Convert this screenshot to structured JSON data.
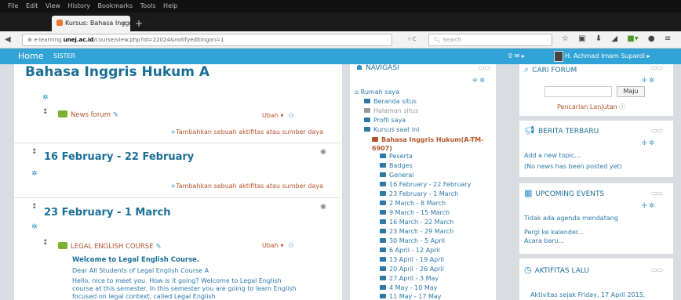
{
  "browser": {
    "menu": [
      "File",
      "Edit",
      "View",
      "History",
      "Bookmarks",
      "Tools",
      "Help"
    ],
    "tab_title": "Kursus: Bahasa Inggris Huk...",
    "url_pre": "e-learning.",
    "url_host": "unej.ac.id",
    "url_post": "/course/view.php?id=22024&notifyeditingon=1",
    "search_placeholder": "Search"
  },
  "topbar": {
    "home": "Home",
    "sister": "SISTER",
    "messages": "0",
    "user": "H. Achmad Imam Supardi"
  },
  "main": {
    "course_title": "Bahasa Inggris Hukum A",
    "news_forum": "News forum",
    "edit_label": "Ubah",
    "add_activity": "Tambahkan sebuah aktifitas atau sumber daya",
    "sections": [
      {
        "title": "16 February - 22 February"
      },
      {
        "title": "23 February - 1 March"
      }
    ],
    "legal_course": "LEGAL ENGLISH COURSE",
    "welcome": "Welcome to Legal English Course.",
    "greeting": "Dear All Students of Legal English Course A",
    "body": "Hello, nice to meet you. How is it going? Welcome to Legal English course at this semester. In this semester you are going to learn English focused on legal context, called Legal English"
  },
  "navigation": {
    "title": "NAVIGASI",
    "rumah": "Rumah saya",
    "beranda": "Beranda situs",
    "halaman": "Halaman situs",
    "profil": "Profil saya",
    "kursus": "Kursus saat ini",
    "current_course": "Bahasa Inggris Hukum(A-TM-6907)",
    "items": [
      "Peserta",
      "Badges",
      "General",
      "16 February - 22 February",
      "23 February - 1 March",
      "2 March - 8 March",
      "9 March - 15 March",
      "16 March - 22 March",
      "23 March - 29 March",
      "30 March - 5 April",
      "6 April - 12 April",
      "13 April - 19 April",
      "20 April - 26 April",
      "27 April - 3 May",
      "4 May - 10 May",
      "11 May - 17 May"
    ]
  },
  "search_forum": {
    "title": "CARI FORUM",
    "button": "Maju",
    "advanced": "Pencarian Lanjutan"
  },
  "news": {
    "title": "BERITA TERBARU",
    "add_topic": "Add a new topic...",
    "no_news": "(No news has been posted yet)"
  },
  "events": {
    "title": "UPCOMING EVENTS",
    "none": "Tidak ada agenda mendatang",
    "goto": "Pergi ke kalender...",
    "new_event": "Acara baru..."
  },
  "recent": {
    "title": "AKTIFITAS LALU",
    "since": "Aktivitas sejak Friday, 17 April 2015,"
  }
}
